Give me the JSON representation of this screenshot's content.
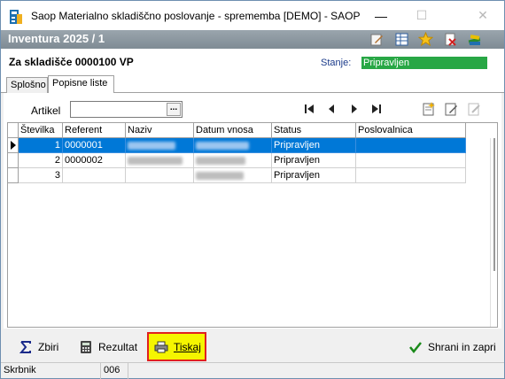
{
  "window": {
    "title": "Saop Materialno skladiščno poslovanje - sprememba [DEMO] - SAOP",
    "min_glyph": "—",
    "max_glyph": "☐",
    "close_glyph": "✕"
  },
  "header": {
    "title": "Inventura 2025 / 1",
    "icons": [
      "edit-icon",
      "table-icon",
      "favorite-star-icon",
      "delete-doc-icon",
      "books-icon"
    ]
  },
  "info": {
    "warehouse": "Za skladišče  0000100 VP",
    "stanje_label": "Stanje:",
    "stanje_value": "Pripravljen",
    "stanje_color": "#28a745"
  },
  "tabs": [
    {
      "label": "Splošno",
      "active": false
    },
    {
      "label": "Popisne liste",
      "active": true
    }
  ],
  "filter": {
    "artikel_label": "Artikel",
    "artikel_value": "",
    "browse_glyph": "..."
  },
  "grid": {
    "columns": [
      "Številka",
      "Referent",
      "Naziv",
      "Datum vnosa",
      "Status",
      "Poslovalnica"
    ],
    "rows": [
      {
        "stevilka": "1",
        "referent": "0000001",
        "naziv": "",
        "datum": "",
        "status": "Pripravljen",
        "poslovalnica": "",
        "selected": true
      },
      {
        "stevilka": "2",
        "referent": "0000002",
        "naziv": "",
        "datum": "",
        "status": "Pripravljen",
        "poslovalnica": "",
        "selected": false
      },
      {
        "stevilka": "3",
        "referent": "",
        "naziv": "",
        "datum": "",
        "status": "Pripravljen",
        "poslovalnica": "",
        "selected": false
      }
    ]
  },
  "actions": {
    "zbiri": "Zbiri",
    "rezultat": "Rezultat",
    "tiskaj": "Tiskaj",
    "shrani": "Shrani in zapri"
  },
  "statusbar": {
    "user": "Skrbnik",
    "code": "006"
  },
  "colors": {
    "selection": "#0078d7",
    "highlight": "#f5f500",
    "highlight_border": "#e02020"
  }
}
